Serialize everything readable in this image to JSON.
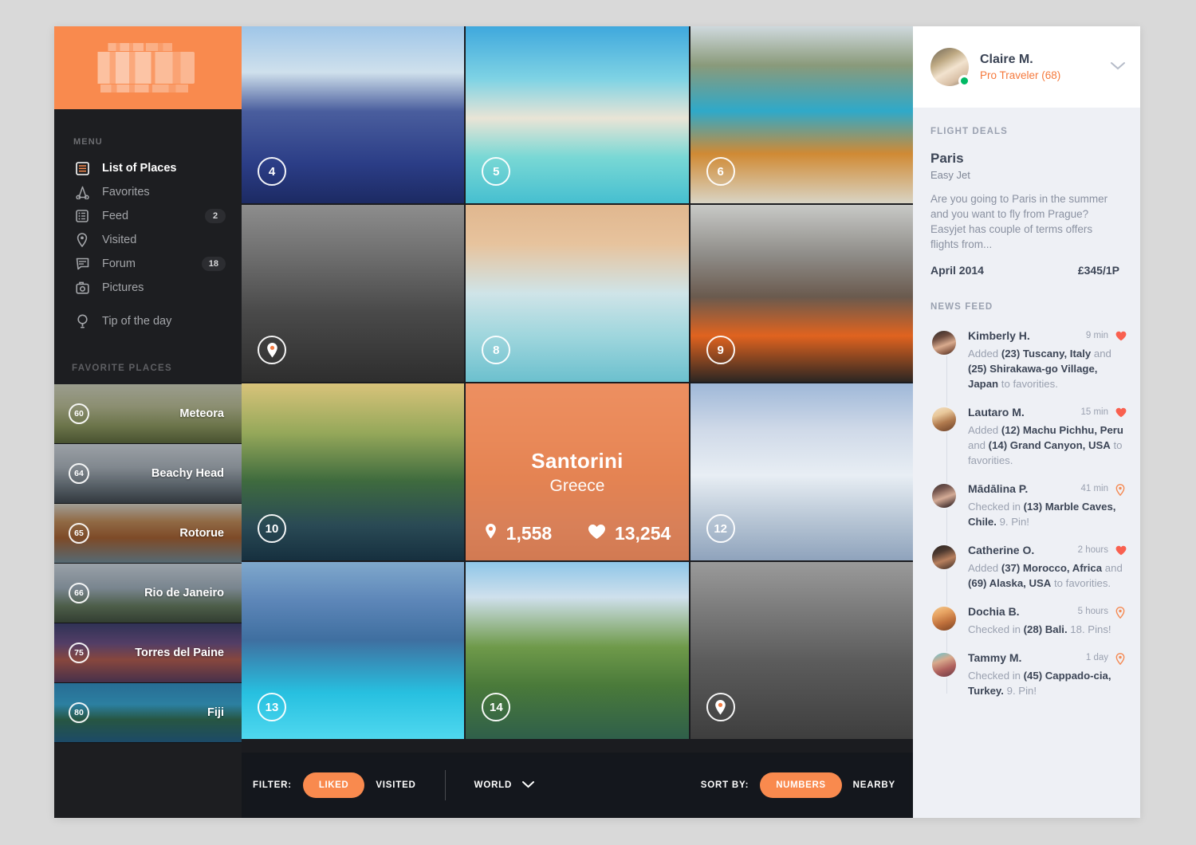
{
  "app": {
    "brand_color": "#f98a4e",
    "logo_alt": "redacted-logo"
  },
  "sidebar": {
    "menu_label": "MENU",
    "menu": [
      {
        "label": "List of Places",
        "icon": "list-icon",
        "badge": "",
        "active": true
      },
      {
        "label": "Favorites",
        "icon": "favorites-icon",
        "badge": "",
        "active": false
      },
      {
        "label": "Feed",
        "icon": "grid-icon",
        "badge": "2",
        "active": false
      },
      {
        "label": "Visited",
        "icon": "map-pin-icon",
        "badge": "",
        "active": false
      },
      {
        "label": "Forum",
        "icon": "chat-icon",
        "badge": "18",
        "active": false
      },
      {
        "label": "Pictures",
        "icon": "camera-icon",
        "badge": "",
        "active": false
      },
      {
        "label": "Tip of the day",
        "icon": "lightbulb-icon",
        "badge": "",
        "active": false
      }
    ],
    "favorites_label": "FAVORITE PLACES",
    "favorites": [
      {
        "num": "60",
        "name": "Meteora"
      },
      {
        "num": "64",
        "name": "Beachy Head"
      },
      {
        "num": "65",
        "name": "Rotorue"
      },
      {
        "num": "66",
        "name": "Rio de Janeiro"
      },
      {
        "num": "75",
        "name": "Torres del Paine"
      },
      {
        "num": "80",
        "name": "Fiji"
      }
    ]
  },
  "grid": {
    "tiles": [
      {
        "num": "4",
        "kind": "number"
      },
      {
        "num": "5",
        "kind": "number"
      },
      {
        "num": "6",
        "kind": "number"
      },
      {
        "num": "",
        "kind": "pin"
      },
      {
        "num": "8",
        "kind": "number"
      },
      {
        "num": "9",
        "kind": "number"
      },
      {
        "num": "10",
        "kind": "number"
      },
      {
        "num": "",
        "kind": "featured"
      },
      {
        "num": "12",
        "kind": "number"
      },
      {
        "num": "13",
        "kind": "number"
      },
      {
        "num": "14",
        "kind": "number"
      },
      {
        "num": "",
        "kind": "pin"
      }
    ],
    "featured": {
      "title": "Santorini",
      "country": "Greece",
      "pins": "1,558",
      "likes": "13,254"
    }
  },
  "filterbar": {
    "filter_label": "FILTER:",
    "filter_active": "LIKED",
    "filter_other": "VISITED",
    "region": "WORLD",
    "sort_label": "SORT BY:",
    "sort_active": "NUMBERS",
    "sort_other": "NEARBY"
  },
  "right_panel": {
    "profile": {
      "name": "Claire M.",
      "role": "Pro Traveler (68)",
      "status": "online"
    },
    "flight_deals_label": "FLIGHT DEALS",
    "deal": {
      "city": "Paris",
      "airline": "Easy Jet",
      "text": "Are you going to Paris in the summer and you want to fly from Prague? Easyjet has couple of terms offers flights from...",
      "date": "April 2014",
      "price": "£345/1P"
    },
    "news_feed_label": "NEWS FEED",
    "feed": [
      {
        "name": "Kimberly H.",
        "time": "9 min",
        "icon": "heart-icon",
        "html": "Added <b>(23) Tuscany, Italy</b> and <b>(25) Shirakawa-go Village, Japan</b> to favorities."
      },
      {
        "name": "Lautaro M.",
        "time": "15 min",
        "icon": "heart-icon",
        "html": "Added <b>(12) Machu Pichhu, Peru</b> and <b>(14) Grand Canyon, USA</b> to favorities."
      },
      {
        "name": "Mādālina P.",
        "time": "41 min",
        "icon": "pin-icon",
        "html": "Checked in <b>(13) Marble Caves, Chile.</b> 9. Pin!"
      },
      {
        "name": "Catherine O.",
        "time": "2 hours",
        "icon": "heart-icon",
        "html": "Added <b>(37) Morocco, Africa</b> and <b>(69) Alaska, USA</b> to favorities."
      },
      {
        "name": "Dochia B.",
        "time": "5 hours",
        "icon": "pin-icon",
        "html": "Checked in <b>(28) Bali.</b> 18. Pins!"
      },
      {
        "name": "Tammy M.",
        "time": "1 day",
        "icon": "pin-icon",
        "html": "Checked in <b>(45) Cappado-cia, Turkey.</b> 9. Pin!"
      }
    ]
  }
}
